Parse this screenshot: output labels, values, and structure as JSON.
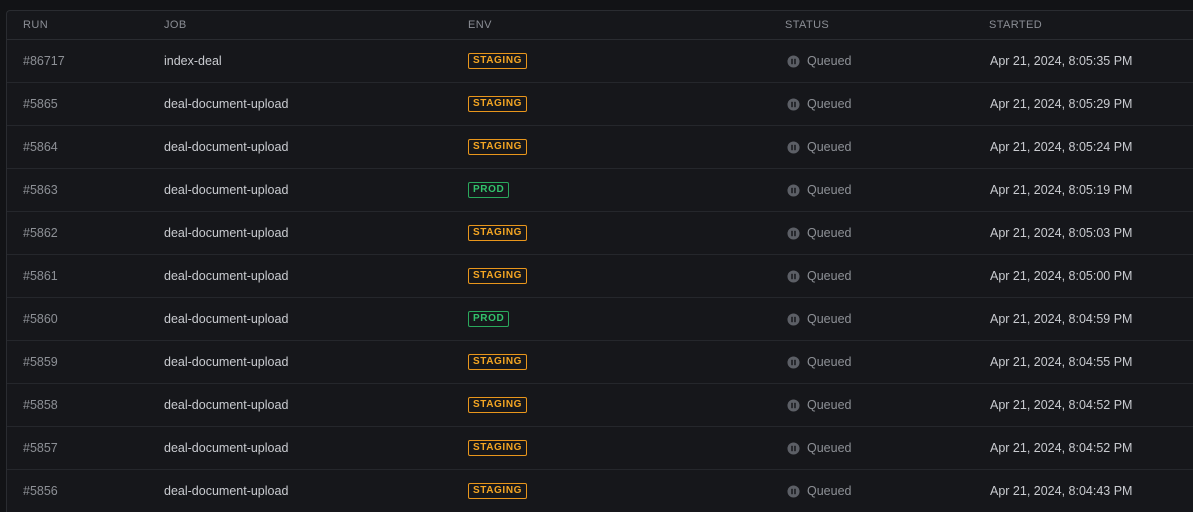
{
  "columns": {
    "run": "RUN",
    "job": "JOB",
    "env": "ENV",
    "status": "STATUS",
    "started": "STARTED"
  },
  "colors": {
    "staging": "#f5a623",
    "prod": "#32c36c",
    "queued": "#8d9096"
  },
  "status_icon": "pause-circle-icon",
  "rows": [
    {
      "run": "#86717",
      "job": "index-deal",
      "env": "STAGING",
      "env_type": "staging",
      "status": "Queued",
      "started": "Apr 21, 2024, 8:05:35 PM"
    },
    {
      "run": "#5865",
      "job": "deal-document-upload",
      "env": "STAGING",
      "env_type": "staging",
      "status": "Queued",
      "started": "Apr 21, 2024, 8:05:29 PM"
    },
    {
      "run": "#5864",
      "job": "deal-document-upload",
      "env": "STAGING",
      "env_type": "staging",
      "status": "Queued",
      "started": "Apr 21, 2024, 8:05:24 PM"
    },
    {
      "run": "#5863",
      "job": "deal-document-upload",
      "env": "PROD",
      "env_type": "prod",
      "status": "Queued",
      "started": "Apr 21, 2024, 8:05:19 PM"
    },
    {
      "run": "#5862",
      "job": "deal-document-upload",
      "env": "STAGING",
      "env_type": "staging",
      "status": "Queued",
      "started": "Apr 21, 2024, 8:05:03 PM"
    },
    {
      "run": "#5861",
      "job": "deal-document-upload",
      "env": "STAGING",
      "env_type": "staging",
      "status": "Queued",
      "started": "Apr 21, 2024, 8:05:00 PM"
    },
    {
      "run": "#5860",
      "job": "deal-document-upload",
      "env": "PROD",
      "env_type": "prod",
      "status": "Queued",
      "started": "Apr 21, 2024, 8:04:59 PM"
    },
    {
      "run": "#5859",
      "job": "deal-document-upload",
      "env": "STAGING",
      "env_type": "staging",
      "status": "Queued",
      "started": "Apr 21, 2024, 8:04:55 PM"
    },
    {
      "run": "#5858",
      "job": "deal-document-upload",
      "env": "STAGING",
      "env_type": "staging",
      "status": "Queued",
      "started": "Apr 21, 2024, 8:04:52 PM"
    },
    {
      "run": "#5857",
      "job": "deal-document-upload",
      "env": "STAGING",
      "env_type": "staging",
      "status": "Queued",
      "started": "Apr 21, 2024, 8:04:52 PM"
    },
    {
      "run": "#5856",
      "job": "deal-document-upload",
      "env": "STAGING",
      "env_type": "staging",
      "status": "Queued",
      "started": "Apr 21, 2024, 8:04:43 PM"
    }
  ]
}
